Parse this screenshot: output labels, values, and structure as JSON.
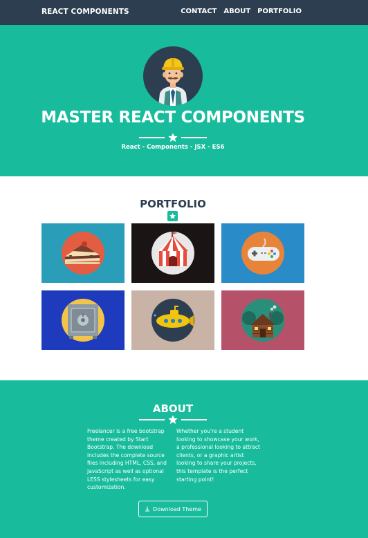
{
  "navbar": {
    "brand": "REACT COMPONENTS",
    "links": [
      "CONTACT",
      "ABOUT",
      "PORTFOLIO"
    ]
  },
  "header": {
    "title": "MASTER REACT COMPONENTS",
    "subtitle": "React - Components - JSX - ES6"
  },
  "portfolio": {
    "title": "PORTFOLIO",
    "items": [
      {
        "name": "cake",
        "bg": "#2a9eb8"
      },
      {
        "name": "circus",
        "bg": "#1a1a1a"
      },
      {
        "name": "game",
        "bg": "#2a8bc9"
      },
      {
        "name": "safe",
        "bg": "#1d3bbc"
      },
      {
        "name": "submarine",
        "bg": "#c9b3a6"
      },
      {
        "name": "cabin",
        "bg": "#b5526a"
      }
    ]
  },
  "about": {
    "title": "ABOUT",
    "col1": "Freelancer is a free bootstrap theme created by Start Bootstrap. The download includes the complete source files including HTML, CSS, and JavaScript as well as optional LESS stylesheets for easy customization.",
    "col2": "Whether you're a student looking to showcase your work, a professional looking to attract clients, or a graphic artist looking to share your projects, this template is the perfect starting point!",
    "download_label": "Download Theme"
  },
  "colors": {
    "primary": "#2c3e50",
    "accent": "#18bc9c"
  }
}
